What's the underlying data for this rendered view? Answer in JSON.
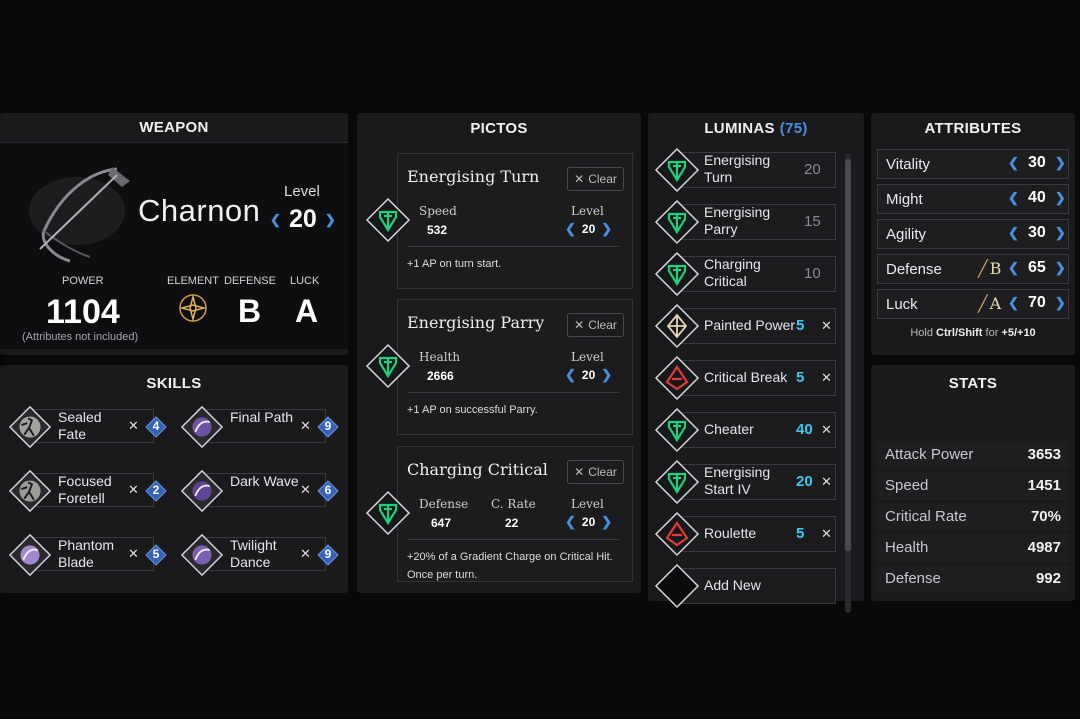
{
  "weapon": {
    "title": "WEAPON",
    "name": "Charnon",
    "level_label": "Level",
    "level": "20",
    "power_label": "POWER",
    "power": "1104",
    "power_note": "(Attributes not included)",
    "element_label": "ELEMENT",
    "defense_label": "DEFENSE",
    "defense": "B",
    "luck_label": "LUCK",
    "luck": "A"
  },
  "skills": {
    "title": "SKILLS",
    "items": [
      {
        "name": "Sealed Fate",
        "cost": "4"
      },
      {
        "name": "Final Path",
        "cost": "9"
      },
      {
        "name": "Focused Foretell",
        "cost": "2"
      },
      {
        "name": "Dark Wave",
        "cost": "6"
      },
      {
        "name": "Phantom Blade",
        "cost": "5"
      },
      {
        "name": "Twilight Dance",
        "cost": "9"
      }
    ]
  },
  "pictos": {
    "title": "PICTOS",
    "clear_label": "Clear",
    "level_label": "Level",
    "items": [
      {
        "name": "Energising Turn",
        "stat1_label": "Speed",
        "stat1": "532",
        "level": "20",
        "desc": "+1 AP on turn start."
      },
      {
        "name": "Energising Parry",
        "stat1_label": "Health",
        "stat1": "2666",
        "level": "20",
        "desc": "+1 AP on successful Parry."
      },
      {
        "name": "Charging Critical",
        "stat1_label": "Defense",
        "stat1": "647",
        "stat2_label": "C. Rate",
        "stat2": "22",
        "level": "20",
        "desc": "+20% of a Gradient Charge on Critical Hit. Once per turn."
      }
    ]
  },
  "luminas": {
    "title": "LUMINAS",
    "count": "(75)",
    "items": [
      {
        "name": "Energising Turn",
        "cost": "20"
      },
      {
        "name": "Energising Parry",
        "cost": "15"
      },
      {
        "name": "Charging Critical",
        "cost": "10"
      },
      {
        "name": "Painted Power",
        "cost": "5"
      },
      {
        "name": "Critical Break",
        "cost": "5"
      },
      {
        "name": "Cheater",
        "cost": "40"
      },
      {
        "name": "Energising Start IV",
        "cost": "20"
      },
      {
        "name": "Roulette",
        "cost": "5"
      },
      {
        "name": "Add New"
      }
    ]
  },
  "attributes": {
    "title": "ATTRIBUTES",
    "items": [
      {
        "name": "Vitality",
        "value": "30"
      },
      {
        "name": "Might",
        "value": "40"
      },
      {
        "name": "Agility",
        "value": "30"
      },
      {
        "name": "Defense",
        "grade": "B",
        "value": "65"
      },
      {
        "name": "Luck",
        "grade": "A",
        "value": "70"
      }
    ],
    "hint_prefix": "Hold",
    "hint_keys": "Ctrl/Shift",
    "hint_for": "for",
    "hint_values": "+5/+10"
  },
  "stats": {
    "title": "STATS",
    "items": [
      {
        "name": "Attack Power",
        "value": "3653"
      },
      {
        "name": "Speed",
        "value": "1451"
      },
      {
        "name": "Critical Rate",
        "value": "70%"
      },
      {
        "name": "Health",
        "value": "4987"
      },
      {
        "name": "Defense",
        "value": "992"
      }
    ]
  },
  "colors": {
    "accent_blue": "#4a90e2",
    "lumina_green": "#1fd07a",
    "lumina_red": "#e03a3a",
    "cost_cyan": "#3cc8f0"
  }
}
